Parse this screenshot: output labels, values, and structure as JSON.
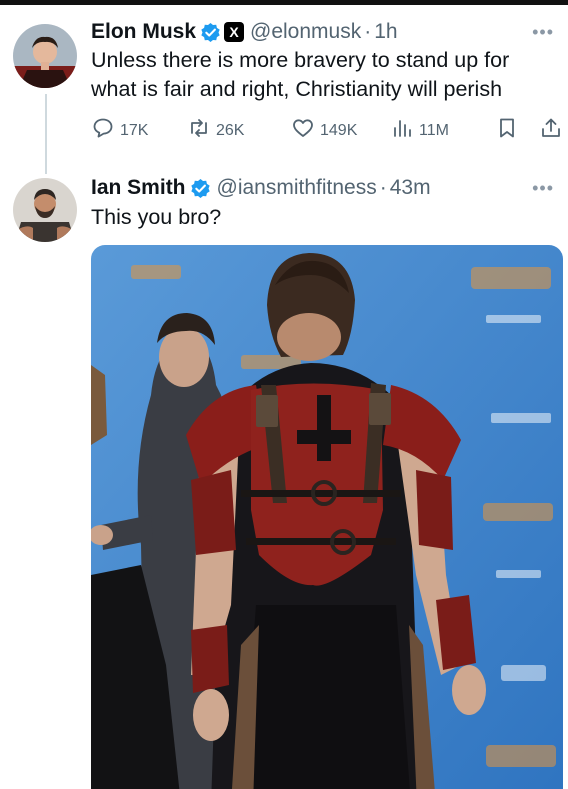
{
  "tweets": [
    {
      "author": {
        "name": "Elon Musk",
        "handle": "@elonmusk",
        "verified": true,
        "affiliate_badge": "X"
      },
      "separator": "·",
      "time": "1h",
      "text": "Unless there is more bravery to stand up for what is fair and right, Christianity will perish",
      "stats": {
        "replies": "17K",
        "retweets": "26K",
        "likes": "149K",
        "views": "11M"
      }
    },
    {
      "author": {
        "name": "Ian Smith",
        "handle": "@iansmithfitness",
        "verified": true
      },
      "separator": "·",
      "time": "43m",
      "text": "This you bro?"
    }
  ],
  "icons": [
    "more-icon",
    "verified-icon",
    "x-badge-icon",
    "reply-icon",
    "retweet-icon",
    "like-icon",
    "views-icon",
    "bookmark-icon",
    "share-icon"
  ],
  "colors": {
    "verified": "#1d9bf0",
    "muted": "#536471",
    "text": "#0f1419",
    "backdrop": "#4a8fd0",
    "leather": "#8a1e1a"
  }
}
